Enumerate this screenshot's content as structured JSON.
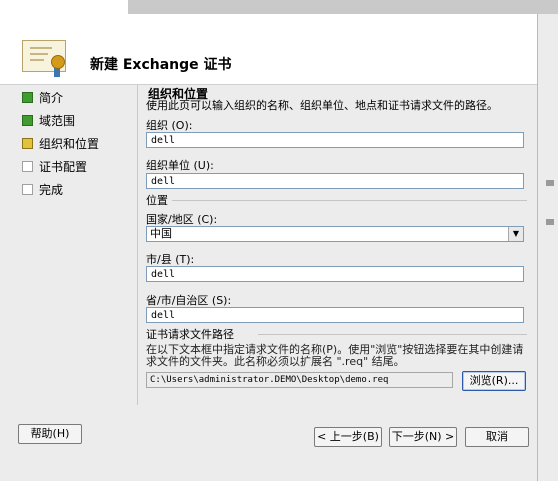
{
  "dialog": {
    "title": "新建 Exchange 证书"
  },
  "nav": {
    "items": [
      {
        "label": "简介",
        "state": "done"
      },
      {
        "label": "域范围",
        "state": "done"
      },
      {
        "label": "组织和位置",
        "state": "current"
      },
      {
        "label": "证书配置",
        "state": "pending"
      },
      {
        "label": "完成",
        "state": "pending"
      }
    ]
  },
  "main": {
    "section_title": "组织和位置",
    "description": "使用此页可以输入组织的名称、组织单位、地点和证书请求文件的路径。",
    "org_label": "组织 (O):",
    "org_value": "dell",
    "orgunit_label": "组织单位 (U):",
    "orgunit_value": "dell",
    "location_group": "位置",
    "country_label": "国家/地区 (C):",
    "country_value": "中国",
    "city_label": "市/县 (T):",
    "city_value": "dell",
    "state_label": "省/市/自治区 (S):",
    "state_value": "dell",
    "reqfile_group": "证书请求文件路径",
    "reqfile_help": "在以下文本框中指定请求文件的名称(P)。使用\"浏览\"按钮选择要在其中创建请求文件的文件夹。此名称必须以扩展名 \".req\" 结尾。",
    "reqfile_path": "C:\\Users\\administrator.DEMO\\Desktop\\demo.req",
    "browse_label": "浏览(R)..."
  },
  "footer": {
    "help_label": "帮助(H)",
    "back_label": "< 上一步(B)",
    "next_label": "下一步(N) >",
    "cancel_label": "取消"
  },
  "colors": {
    "done": "#3f9c2e",
    "current": "#e2c13b",
    "field_border": "#7f9db9"
  }
}
